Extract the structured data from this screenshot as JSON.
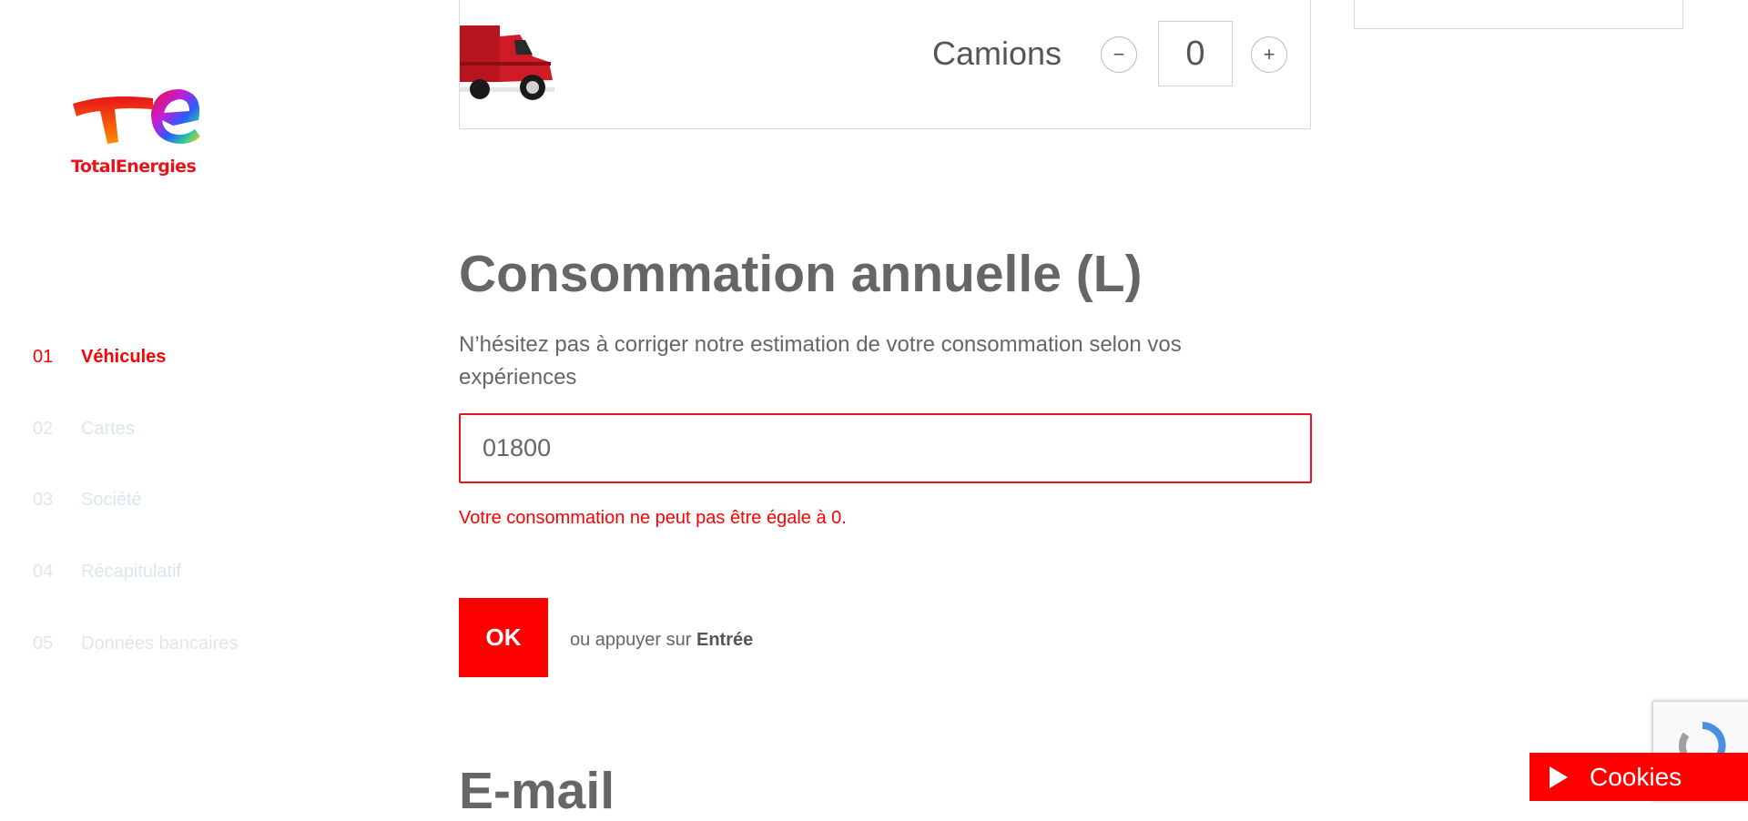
{
  "brand": {
    "name": "TotalEnergies"
  },
  "steps": [
    {
      "num": "01",
      "label": "Véhicules",
      "active": true
    },
    {
      "num": "02",
      "label": "Cartes",
      "active": false
    },
    {
      "num": "03",
      "label": "Société",
      "active": false
    },
    {
      "num": "04",
      "label": "Récapitulatif",
      "active": false
    },
    {
      "num": "05",
      "label": "Données bancaires",
      "active": false
    }
  ],
  "vehicle": {
    "label": "Camions",
    "count": "0",
    "minus": "−",
    "plus": "+"
  },
  "consumption": {
    "title": "Consommation annuelle (L)",
    "description": "N’hésitez pas à corriger notre estimation de votre consommation selon vos expériences",
    "value": "01800",
    "error": "Votre consommation ne peut pas être égale à 0."
  },
  "actions": {
    "ok_label": "OK",
    "hint_prefix": "ou appuyer sur",
    "hint_key": "Entrée"
  },
  "email": {
    "title": "E-mail"
  },
  "cookies": {
    "label": "Cookies"
  },
  "colors": {
    "accent": "#ff0000",
    "text": "#666666",
    "inactive_step": "#dde6ee"
  },
  "icons": {
    "truck": "truck-icon",
    "cookies": "play-icon",
    "recaptcha": "recaptcha-icon"
  }
}
